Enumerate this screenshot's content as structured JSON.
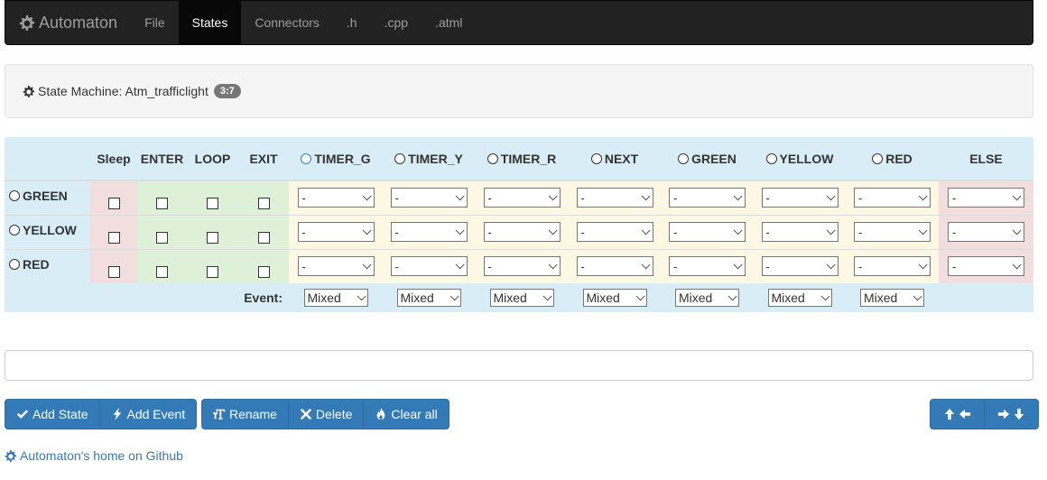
{
  "navbar": {
    "brand": "Automaton",
    "brand_icon": "gear-icon",
    "items": [
      {
        "label": "File",
        "active": false
      },
      {
        "label": "States",
        "active": true
      },
      {
        "label": "Connectors",
        "active": false
      },
      {
        "label": ".h",
        "active": false
      },
      {
        "label": ".cpp",
        "active": false
      },
      {
        "label": ".atml",
        "active": false
      }
    ]
  },
  "panel": {
    "title": "State Machine: Atm_trafficlight",
    "badge": "3:7"
  },
  "table": {
    "action_headers": [
      "Sleep",
      "ENTER",
      "LOOP",
      "EXIT"
    ],
    "event_headers": [
      "TIMER_G",
      "TIMER_Y",
      "TIMER_R",
      "NEXT",
      "GREEN",
      "YELLOW",
      "RED"
    ],
    "else_header": "ELSE",
    "states": [
      {
        "name": "GREEN",
        "sleep": false,
        "enter": false,
        "loop": false,
        "exit": false,
        "transitions": [
          "-",
          "-",
          "-",
          "-",
          "-",
          "-",
          "-"
        ],
        "else": "-"
      },
      {
        "name": "YELLOW",
        "sleep": false,
        "enter": false,
        "loop": false,
        "exit": false,
        "transitions": [
          "-",
          "-",
          "-",
          "-",
          "-",
          "-",
          "-"
        ],
        "else": "-"
      },
      {
        "name": "RED",
        "sleep": false,
        "enter": false,
        "loop": false,
        "exit": false,
        "transitions": [
          "-",
          "-",
          "-",
          "-",
          "-",
          "-",
          "-"
        ],
        "else": "-"
      }
    ],
    "event_label": "Event:",
    "event_types": [
      "Mixed",
      "Mixed",
      "Mixed",
      "Mixed",
      "Mixed",
      "Mixed",
      "Mixed"
    ]
  },
  "command_input": {
    "value": "",
    "placeholder": ""
  },
  "buttons": {
    "add_state": "Add State",
    "add_event": "Add Event",
    "rename": "Rename",
    "delete": "Delete",
    "clear_all": "Clear all"
  },
  "footer": {
    "link": "Automaton's home on Github"
  },
  "colors": {
    "primary": "#337ab7",
    "info": "#d9edf7",
    "danger": "#f2dede",
    "success": "#dff0d8",
    "warning": "#fcf8e3"
  }
}
